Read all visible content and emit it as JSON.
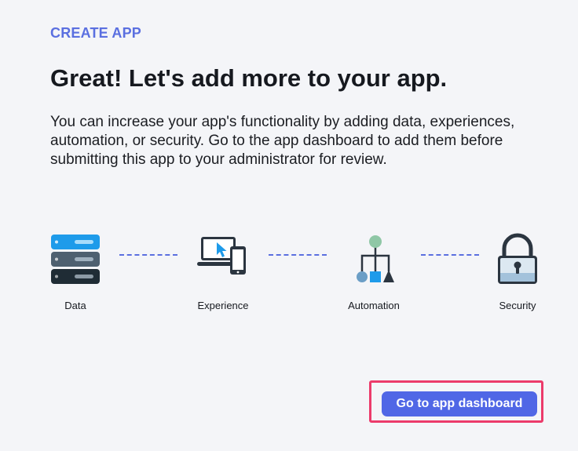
{
  "header": {
    "eyebrow": "CREATE APP",
    "title": "Great! Let's add more to your app.",
    "description": "You can increase your app's functionality by adding data, experiences, automation, or security. Go to the app dashboard to add them before submitting this app to your administrator for review."
  },
  "steps": [
    {
      "label": "Data",
      "icon": "database-icon"
    },
    {
      "label": "Experience",
      "icon": "devices-icon"
    },
    {
      "label": "Automation",
      "icon": "workflow-icon"
    },
    {
      "label": "Security",
      "icon": "lock-icon"
    }
  ],
  "actions": {
    "primary_label": "Go to app dashboard"
  },
  "colors": {
    "accent": "#5a6fe0",
    "button": "#5067e6",
    "highlight": "#ec3b6b",
    "background": "#f4f5f8"
  }
}
